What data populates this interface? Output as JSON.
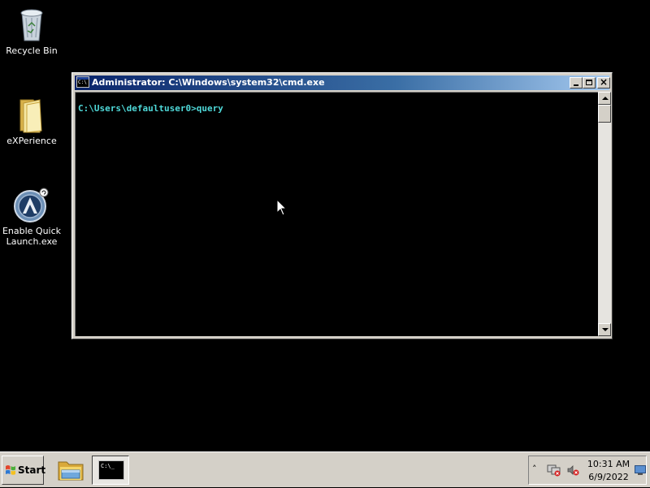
{
  "desktop": {
    "icons": [
      {
        "label": "Recycle Bin",
        "icon": "recycle-bin-icon"
      },
      {
        "label": "eXPerience",
        "icon": "folder-icon"
      },
      {
        "label": "Enable Quick\nLaunch.exe",
        "icon": "app-launcher-icon"
      }
    ]
  },
  "window": {
    "title": "Administrator: C:\\Windows\\system32\\cmd.exe",
    "icon_text": "C:\\",
    "minimize": "minimize",
    "maximize": "maximize",
    "close": "×"
  },
  "console": {
    "prompt_line": "C:\\Users\\defaultuser0>query",
    "text_color": "#4fd9d9",
    "background": "#000000"
  },
  "taskbar": {
    "start_label": "Start",
    "cmd_icon_text": "C:\\_",
    "tray": {
      "chevron": "˄",
      "time": "10:31 AM",
      "date": "6/9/2022"
    }
  }
}
